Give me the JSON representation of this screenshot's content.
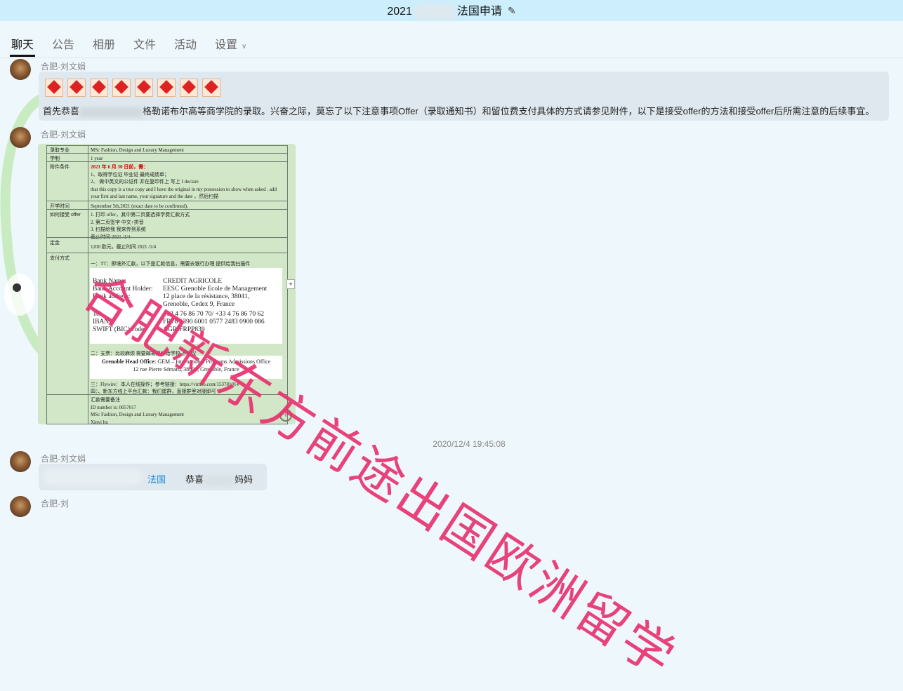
{
  "titlebar": {
    "prefix": "2021",
    "suffix": "法国申请"
  },
  "tabs": [
    "聊天",
    "公告",
    "相册",
    "文件",
    "活动",
    "设置"
  ],
  "messages": [
    {
      "sender": "合肥-刘文娟",
      "text": "首先恭喜",
      "text2": "格勒诺布尔高等商学院的录取。兴奋之际，莫忘了以下注意事项Offer（录取通知书）和留位费支付具体的方式请参见附件，以下是接受offer的方法和接受offer后所需注意的后续事宜。"
    },
    {
      "sender": "合肥-刘文娟"
    },
    {
      "sender": "合肥-刘文娟",
      "mention": "法国",
      "text": "恭喜",
      "text_end": "妈妈"
    },
    {
      "sender": "合肥-刘"
    }
  ],
  "doc": {
    "rows": [
      {
        "label": "录取专业",
        "lines": [
          "MSc Fashion, Design and Luxury Management"
        ]
      },
      {
        "label": "学制",
        "lines": [
          "1 year"
        ]
      },
      {
        "label": "附件条件",
        "lines": [
          "2021 年 6 月 30 日前，需：",
          "1、取得学位证 毕业证 最终成绩单；",
          "2、 做中英文的公证件 并在复印件上 写上 I declare",
          "that this copy is a true copy and I have the original in my possession to show when asked . add",
          "your first and last name, your signature and the date ，然后扫描"
        ]
      },
      {
        "label": "开学时间",
        "lines": [
          "September 5th,2021 (exact date to be confirmed)."
        ]
      },
      {
        "label": "如何接受 offer",
        "lines": [
          "1. 打印 offer，其中第二页要选择学费汇款方式",
          "2. 第二页签字 中文+拼音",
          "3. 扫描给我 我来传到系统",
          "截止时间 2021 /1/4"
        ]
      },
      {
        "label": "定金",
        "lines": [
          "1200 欧元，截止时间 2021 /1/4"
        ]
      },
      {
        "label": "支付方式",
        "lines": [
          "一：TT：即境外汇款，以下是汇款信息，需要去银行办理 提供给我扫描件"
        ]
      },
      {
        "label": "",
        "lines": [
          "汇款需要备注",
          "ID number is: 0057017",
          "MSc Fashion, Design and Luxury Management",
          "Xinyi hu"
        ]
      }
    ],
    "bank": [
      [
        "Bank Name:",
        "CREDIT AGRICOLE"
      ],
      [
        "Bank Account Holder:",
        "EESC Grenoble Ecole de Management"
      ],
      [
        "Bank address:",
        "12 place de la résistance, 38041,"
      ],
      [
        "",
        "Grenoble, Cedex 9, France"
      ],
      [
        "Tel",
        "+33 4 76 86 70 70/ +33 4 76 86 70 62"
      ],
      [
        "IBAN:",
        "FR76 1390 6001 0577 2483 0900 086"
      ],
      [
        "SWIFT (BIC) code:",
        "AGRIFRPP839"
      ]
    ],
    "cheque": "二：支票：比较麻烦 需要邮寄原件给学校 不建议",
    "gem_label": "Grenoble Head Office:",
    "gem_rest": " GEM – International Programs Admissions Office",
    "gem_addr": "12 rue Pierre Sémard, 38000, Grenoble, France",
    "flywire": "三：Flywire：本人在线操作；参考链接：https://vimeo.com/153781014",
    "other": "四：、新东方线上平台汇款：我们建群，直接群里对接即可"
  },
  "timestamp": "2020/12/4 19:45:08",
  "watermark": "合肥新东方前途出国欧洲留学",
  "colors": {
    "watermark": "#e8336f",
    "titlebar": "#cdeefc",
    "bubble": "#dfe8ee",
    "doc_bg": "#d1e7c7"
  }
}
